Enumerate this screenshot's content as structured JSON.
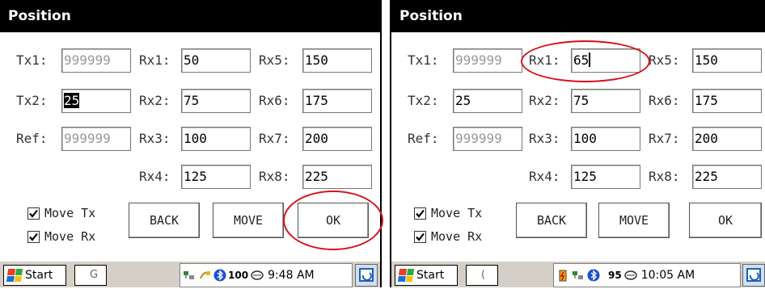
{
  "left": {
    "title": "Position",
    "labels": {
      "tx1": "Tx1:",
      "tx2": "Tx2:",
      "ref": "Ref:",
      "rx1": "Rx1:",
      "rx2": "Rx2:",
      "rx3": "Rx3:",
      "rx4": "Rx4:",
      "rx5": "Rx5:",
      "rx6": "Rx6:",
      "rx7": "Rx7:",
      "rx8": "Rx8:"
    },
    "values": {
      "tx1": "999999",
      "tx2": "25",
      "ref": "999999",
      "rx1": "50",
      "rx2": "75",
      "rx3": "100",
      "rx4": "125",
      "rx5": "150",
      "rx6": "175",
      "rx7": "200",
      "rx8": "225"
    },
    "move_tx": "Move Tx",
    "move_rx": "Move Rx",
    "back": "BACK",
    "move": "MOVE",
    "ok": "OK",
    "start": "Start",
    "task_char": "G",
    "clock": "9:48 AM",
    "tray_num": "100"
  },
  "right": {
    "title": "Position",
    "labels": {
      "tx1": "Tx1:",
      "tx2": "Tx2:",
      "ref": "Ref:",
      "rx1": "Rx1:",
      "rx2": "Rx2:",
      "rx3": "Rx3:",
      "rx4": "Rx4:",
      "rx5": "Rx5:",
      "rx6": "Rx6:",
      "rx7": "Rx7:",
      "rx8": "Rx8:"
    },
    "values": {
      "tx1": "999999",
      "tx2": "25",
      "ref": "999999",
      "rx1": "65",
      "rx2": "75",
      "rx3": "100",
      "rx4": "125",
      "rx5": "150",
      "rx6": "175",
      "rx7": "200",
      "rx8": "225"
    },
    "move_tx": "Move Tx",
    "move_rx": "Move Rx",
    "back": "BACK",
    "move": "MOVE",
    "ok": "OK",
    "start": "Start",
    "task_char": "(",
    "clock": "10:05 AM",
    "tray_num": "95"
  },
  "colors": {
    "highlight": "#d8101c",
    "titlebar": "#000000",
    "taskbar": "#d4d0c8"
  },
  "icons": [
    "windows-flag-icon",
    "network-icon",
    "power-plug-icon",
    "bluetooth-icon",
    "signal-icon",
    "battery-icon",
    "desktop-icon"
  ]
}
